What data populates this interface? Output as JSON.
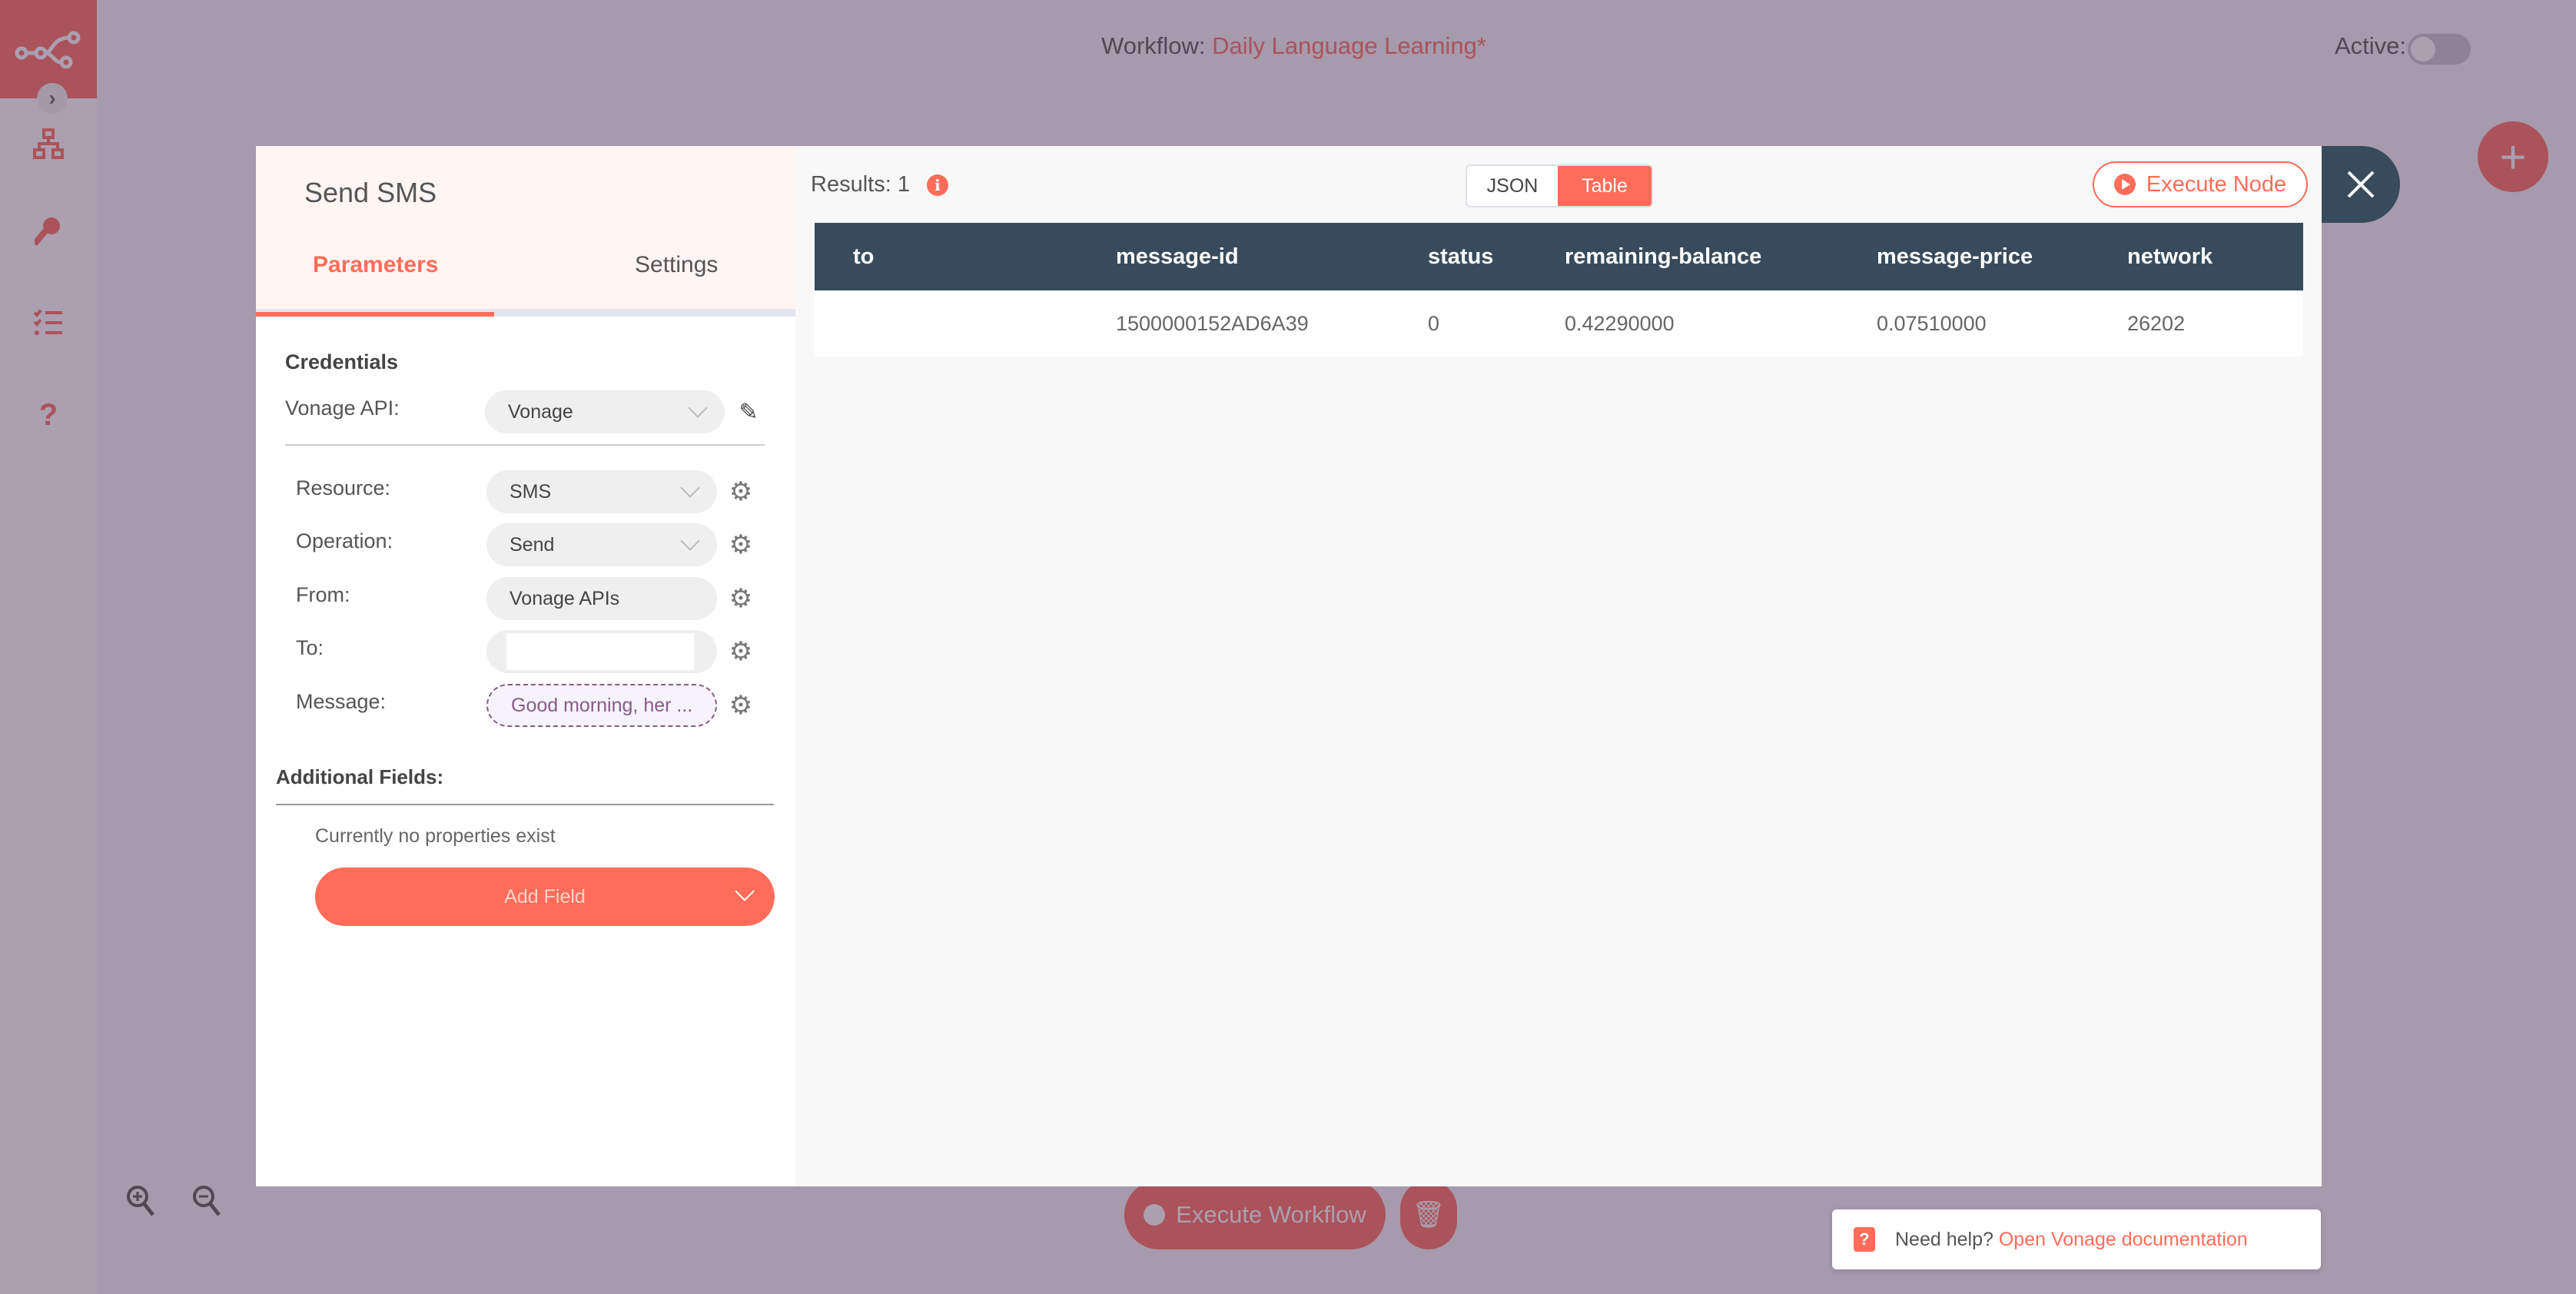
{
  "header": {
    "workflow_label": "Workflow:",
    "workflow_name": "Daily Language Learning*",
    "active_label": "Active:",
    "active": false
  },
  "sidebar": {
    "items": [
      {
        "icon": "workflow-network-icon"
      },
      {
        "icon": "key-icon"
      },
      {
        "icon": "task-list-icon"
      },
      {
        "icon": "help-question-icon"
      }
    ]
  },
  "canvas": {
    "execute_workflow_label": "Execute Workflow",
    "add_node_glyph": "+"
  },
  "node": {
    "title": "Send SMS",
    "tabs": [
      {
        "label": "Parameters",
        "active": true
      },
      {
        "label": "Settings",
        "active": false
      }
    ],
    "credentials": {
      "section_title": "Credentials",
      "label": "Vonage API:",
      "value": "Vonage"
    },
    "parameters": [
      {
        "label": "Resource:",
        "value": "SMS",
        "type": "select"
      },
      {
        "label": "Operation:",
        "value": "Send",
        "type": "select"
      },
      {
        "label": "From:",
        "value": "Vonage APIs",
        "type": "text"
      },
      {
        "label": "To:",
        "value": "",
        "type": "text"
      },
      {
        "label": "Message:",
        "value": "Good morning, her ...",
        "type": "expression"
      }
    ],
    "additional_fields": {
      "title": "Additional Fields:",
      "empty_text": "Currently no properties exist",
      "add_button_label": "Add Field"
    }
  },
  "output": {
    "results_label": "Results: 1",
    "view_options": [
      {
        "label": "JSON",
        "active": false
      },
      {
        "label": "Table",
        "active": true
      }
    ],
    "execute_node_label": "Execute Node",
    "table": {
      "columns": [
        "to",
        "message-id",
        "status",
        "remaining-balance",
        "message-price",
        "network"
      ],
      "rows": [
        [
          "",
          "1500000152AD6A39",
          "0",
          "0.42290000",
          "0.07510000",
          "26202"
        ]
      ]
    }
  },
  "help": {
    "prefix": "Need help?",
    "link_text": "Open Vonage documentation"
  },
  "colors": {
    "accent": "#ff6d5a",
    "dark": "#374b5c"
  }
}
